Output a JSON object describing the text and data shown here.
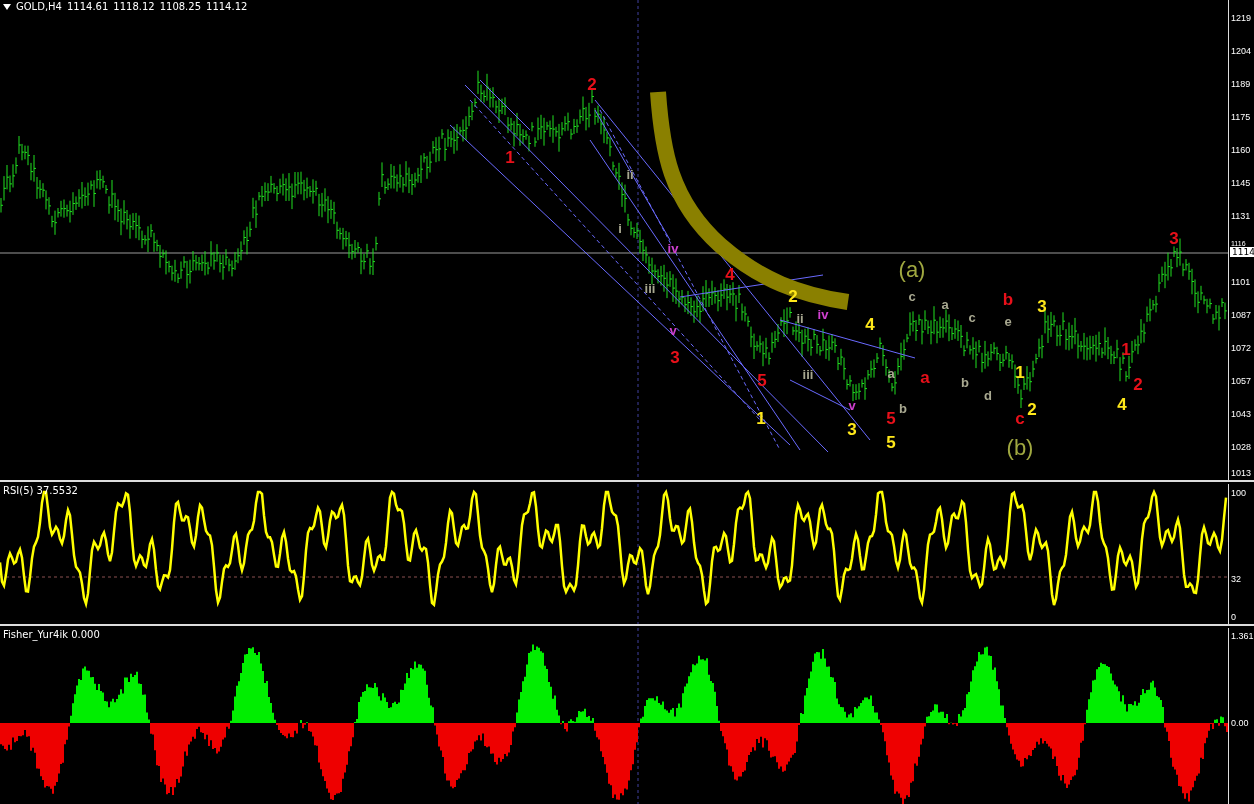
{
  "main_pane": {
    "symbol": "GOLD,H4",
    "ohlc": [
      "1114.61",
      "1118.12",
      "1108.25",
      "1114.12"
    ],
    "price_axis": [
      "1219",
      "1204",
      "1189",
      "1175",
      "1160",
      "1145",
      "1131",
      "1116",
      "1101",
      "1087",
      "1072",
      "1057",
      "1043",
      "1028",
      "1013"
    ],
    "current_price": "1114",
    "wave_labels": [
      {
        "text": "2",
        "kind": "impulse",
        "color": "#e8101a"
      },
      {
        "text": "1",
        "kind": "impulse",
        "color": "#e8101a"
      },
      {
        "text": "ii",
        "kind": "minor",
        "color": "#a8a890"
      },
      {
        "text": "i",
        "kind": "minor",
        "color": "#a8a890"
      },
      {
        "text": "3",
        "kind": "impulse",
        "color": "#e8101a"
      },
      {
        "text": "iv",
        "kind": "minor",
        "color": "#d040d0"
      },
      {
        "text": "4",
        "kind": "impulse",
        "color": "#e8101a"
      },
      {
        "text": "(a)",
        "kind": "degree",
        "color": "#a0a840"
      },
      {
        "text": "iii",
        "kind": "minor",
        "color": "#a8a890"
      },
      {
        "text": "2",
        "kind": "impulse",
        "color": "#ffe81a"
      },
      {
        "text": "c",
        "kind": "minor",
        "color": "#a8a890"
      },
      {
        "text": "b",
        "kind": "impulse",
        "color": "#e8101a"
      },
      {
        "text": "a",
        "kind": "minor",
        "color": "#a8a890"
      },
      {
        "text": "3",
        "kind": "impulse",
        "color": "#ffe81a"
      },
      {
        "text": "v",
        "kind": "minor",
        "color": "#d040d0"
      },
      {
        "text": "ii",
        "kind": "minor",
        "color": "#a8a890"
      },
      {
        "text": "iv",
        "kind": "minor",
        "color": "#d040d0"
      },
      {
        "text": "4",
        "kind": "impulse",
        "color": "#ffe81a"
      },
      {
        "text": "c",
        "kind": "minor",
        "color": "#a8a890"
      },
      {
        "text": "e",
        "kind": "minor",
        "color": "#a8a890"
      },
      {
        "text": "3",
        "kind": "impulse",
        "color": "#e8101a"
      },
      {
        "text": "1",
        "kind": "impulse",
        "color": "#e8101a"
      },
      {
        "text": "5",
        "kind": "impulse",
        "color": "#e8101a"
      },
      {
        "text": "iii",
        "kind": "minor",
        "color": "#a8a890"
      },
      {
        "text": "a",
        "kind": "minor",
        "color": "#a8a890"
      },
      {
        "text": "a",
        "kind": "impulse",
        "color": "#e8101a"
      },
      {
        "text": "b",
        "kind": "minor",
        "color": "#a8a890"
      },
      {
        "text": "1",
        "kind": "impulse",
        "color": "#ffe81a"
      },
      {
        "text": "2",
        "kind": "impulse",
        "color": "#e8101a"
      },
      {
        "text": "v",
        "kind": "minor",
        "color": "#d040d0"
      },
      {
        "text": "b",
        "kind": "minor",
        "color": "#a8a890"
      },
      {
        "text": "d",
        "kind": "minor",
        "color": "#a8a890"
      },
      {
        "text": "2",
        "kind": "impulse",
        "color": "#ffe81a"
      },
      {
        "text": "4",
        "kind": "impulse",
        "color": "#ffe81a"
      },
      {
        "text": "1",
        "kind": "impulse",
        "color": "#ffe81a"
      },
      {
        "text": "3",
        "kind": "impulse",
        "color": "#ffe81a"
      },
      {
        "text": "5",
        "kind": "impulse",
        "color": "#e8101a"
      },
      {
        "text": "c",
        "kind": "impulse",
        "color": "#e8101a"
      },
      {
        "text": "5",
        "kind": "impulse",
        "color": "#ffe81a"
      },
      {
        "text": "(b)",
        "kind": "degree",
        "color": "#a0a840"
      }
    ]
  },
  "rsi_pane": {
    "name": "RSI(5)",
    "value": "37.5532",
    "axis": [
      "100",
      "32",
      "0"
    ]
  },
  "fisher_pane": {
    "name": "Fisher_Yur4ik",
    "value": "0.000",
    "axis": [
      "1.361",
      "0.00"
    ]
  }
}
